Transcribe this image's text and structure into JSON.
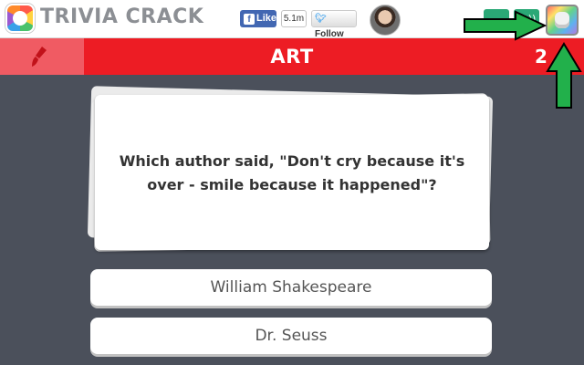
{
  "header": {
    "logo_text": "TRIVIA CRACK",
    "fb_like_label": "Like",
    "fb_like_icon": "f",
    "fb_count": "5.1m",
    "twitter_follow_label": "Follow",
    "twitter_icon": "bird-icon",
    "character_button_icon": "character-icon"
  },
  "category": {
    "name": "ART",
    "timer": "2",
    "icon": "paintbrush-icon"
  },
  "question": {
    "text": "Which author said, \"Don't cry because it's over - smile because it happened\"?"
  },
  "answers": [
    {
      "label": "William Shakespeare"
    },
    {
      "label": "Dr. Seuss"
    }
  ],
  "colors": {
    "category_red": "#ed1c24",
    "background": "#4b505b",
    "arrow_green": "#22b04b"
  }
}
